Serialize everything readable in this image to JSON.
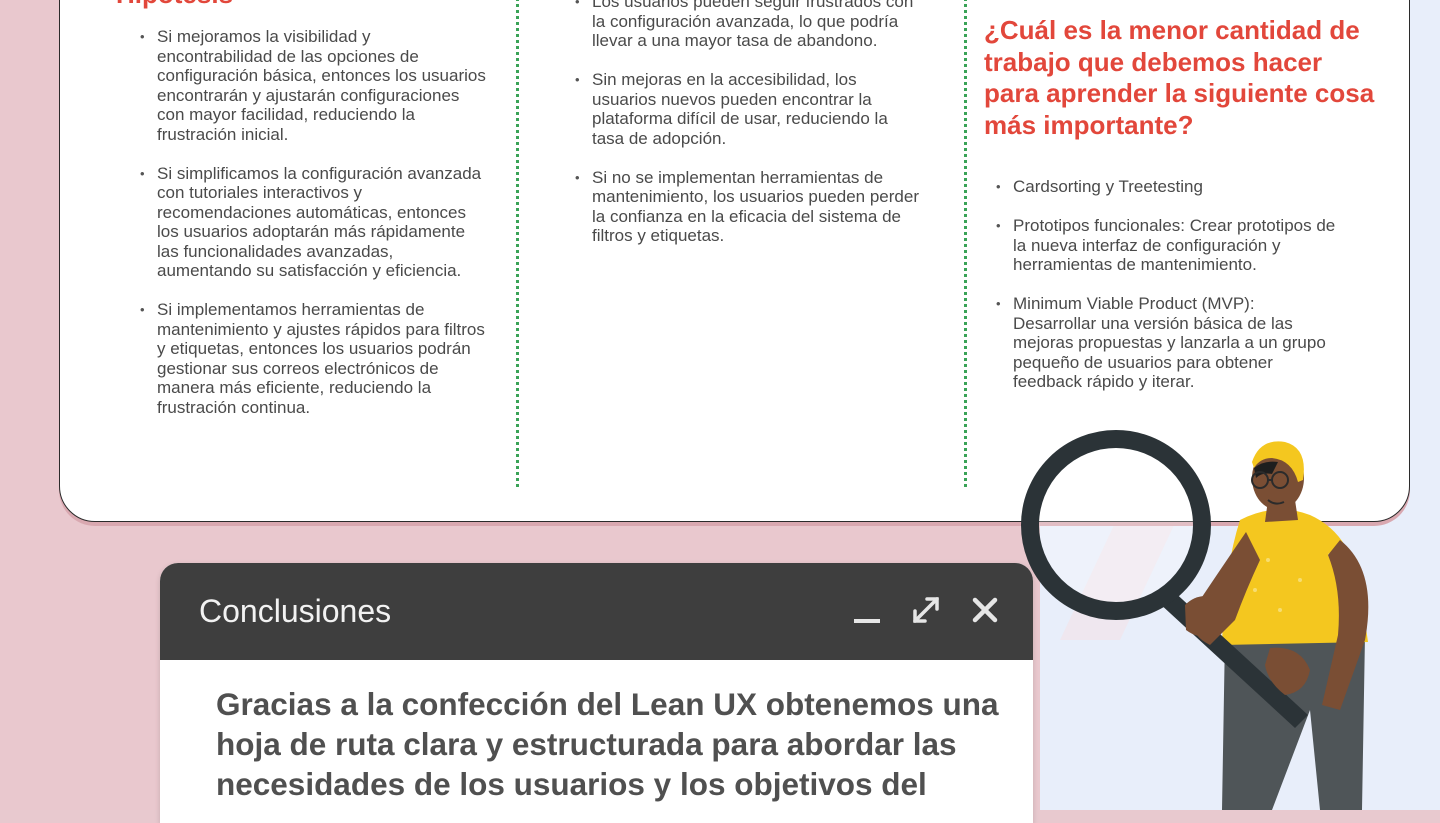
{
  "colors": {
    "accent": "#e2473b",
    "divider": "#3aa357",
    "dialog_header": "#3e3e3e",
    "bg_pink": "#e9c8ce",
    "bg_blue": "#e8eefa"
  },
  "hypotheses": {
    "title": "Hipótesis",
    "items": [
      "Si mejoramos la visibilidad y encontrabilidad de las opciones de configuración básica, entonces los usuarios encontrarán y ajustarán configuraciones con mayor facilidad, reduciendo la frustración inicial.",
      "Si simplificamos la configuración avanzada con tutoriales interactivos y recomendaciones automáticas, entonces los usuarios adoptarán más rápidamente las funcionalidades avanzadas, aumentando su satisfacción y eficiencia.",
      "Si implementamos herramientas de mantenimiento y ajustes rápidos para filtros y etiquetas, entonces los usuarios podrán gestionar sus correos electrónicos de manera más eficiente, reduciendo la frustración continua."
    ]
  },
  "risks": {
    "items": [
      "Los usuarios pueden seguir frustrados con la configuración avanzada, lo que podría llevar a una mayor tasa de abandono.",
      "Sin mejoras en la accesibilidad, los usuarios nuevos pueden encontrar la plataforma difícil de usar, reduciendo la tasa de adopción.",
      "Si no se implementan herramientas de mantenimiento, los usuarios pueden perder la confianza en la eficacia del sistema de filtros y etiquetas."
    ]
  },
  "least_work": {
    "title": "¿Cuál es la menor cantidad de trabajo que debemos hacer para aprender la siguiente cosa más importante?",
    "items": [
      "Cardsorting y Treetesting",
      "Prototipos funcionales: Crear prototipos de la nueva interfaz de configuración y herramientas de mantenimiento.",
      "Minimum Viable Product (MVP): Desarrollar una versión básica de las mejoras propuestas y lanzarla a un grupo pequeño de usuarios para obtener feedback rápido y iterar."
    ]
  },
  "dialog": {
    "title": "Conclusiones",
    "body": "Gracias a la confección del Lean UX obtenemos una hoja de ruta clara y estructurada para abordar las necesidades de los usuarios y los objetivos del",
    "controls": [
      "minimize-icon",
      "expand-icon",
      "close-icon"
    ]
  },
  "illustration": {
    "subject": "person-with-magnifying-glass",
    "shirt_color": "#f4c71f",
    "hat_color": "#f4c71f",
    "pants_color": "#4f5558"
  }
}
